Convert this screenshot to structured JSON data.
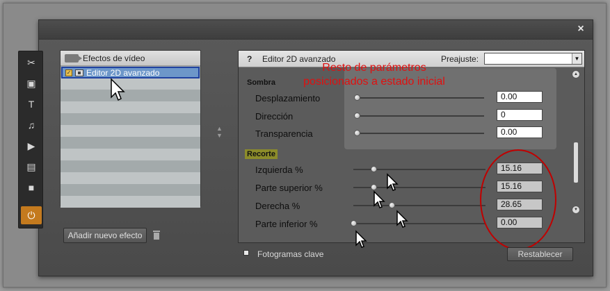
{
  "window": {
    "close_label": "×"
  },
  "toolbar": {
    "tools": [
      {
        "icon": "scissors-icon",
        "glyph": "✂",
        "active": false
      },
      {
        "icon": "image-icon",
        "glyph": "▣",
        "active": false
      },
      {
        "icon": "text-icon",
        "glyph": "T",
        "active": false
      },
      {
        "icon": "music-icon",
        "glyph": "♫",
        "active": false
      },
      {
        "icon": "camera-icon",
        "glyph": "▶",
        "active": false
      },
      {
        "icon": "clapper-icon",
        "glyph": "▤",
        "active": false
      },
      {
        "icon": "square-icon",
        "glyph": "■",
        "active": false
      },
      {
        "icon": "plug-icon",
        "glyph": "⏻",
        "active": true
      }
    ]
  },
  "effects": {
    "title": "Efectos de vídeo",
    "selected_item": "Editor 2D avanzado",
    "add_button": "Añadir nuevo efecto"
  },
  "editor": {
    "help_glyph": "?",
    "title": "Editor 2D avanzado",
    "preset_label": "Preajuste:",
    "preset_value": "",
    "sections": {
      "shadow": {
        "title": "Sombra",
        "params": [
          {
            "label": "Desplazamiento",
            "value": "0.00",
            "slider": 0.0
          },
          {
            "label": "Dirección",
            "value": "0",
            "slider": 0.0
          },
          {
            "label": "Transparencia",
            "value": "0.00",
            "slider": 0.0
          }
        ]
      },
      "crop": {
        "title": "Recorte",
        "params": [
          {
            "label": "Izquierda %",
            "value": "15.16",
            "slider": 0.15
          },
          {
            "label": "Parte superior %",
            "value": "15.16",
            "slider": 0.15
          },
          {
            "label": "Derecha %",
            "value": "28.65",
            "slider": 0.29
          },
          {
            "label": "Parte inferior %",
            "value": "0.00",
            "slider": 0.0
          }
        ]
      }
    },
    "scroll_position": 0.75
  },
  "annotation": {
    "line1": "Resto de parámetros",
    "line2": "posicionados a estado inicial"
  },
  "footer": {
    "keyframes_label": "Fotogramas clave",
    "reset_label": "Restablecer"
  },
  "colors": {
    "annotation": "#e01010",
    "active_tool": "#c47a1e",
    "selection": "#6d97c9",
    "crop_highlight": "#8c8c2a"
  }
}
